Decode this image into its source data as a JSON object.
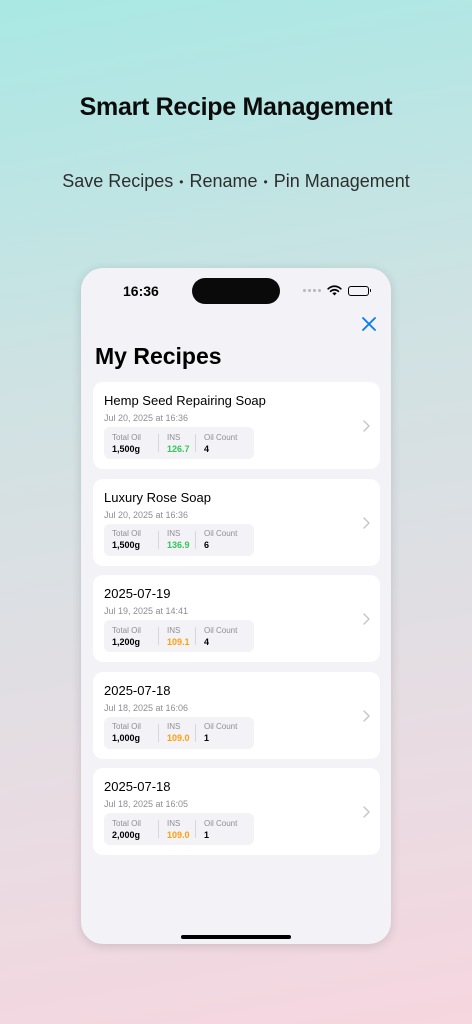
{
  "headline": "Smart Recipe Management",
  "subline": {
    "item1": "Save Recipes",
    "item2": "Rename",
    "item3": "Pin Management",
    "separator": "•"
  },
  "status_bar": {
    "time": "16:36"
  },
  "screen": {
    "title": "My Recipes",
    "close_icon": "close-icon",
    "stat_labels": {
      "total_oil": "Total Oil",
      "ins": "INS",
      "oil_count": "Oil Count"
    }
  },
  "colors": {
    "accent": "#007aff",
    "ins_green": "#34c759",
    "ins_orange": "#ff9f0a"
  },
  "recipes": [
    {
      "name": "Hemp Seed Repairing Soap",
      "date": "Jul 20, 2025 at 16:36",
      "total_oil": "1,500g",
      "ins": "126.7",
      "ins_status": "green",
      "oil_count": "4"
    },
    {
      "name": "Luxury Rose Soap",
      "date": "Jul 20, 2025 at 16:36",
      "total_oil": "1,500g",
      "ins": "136.9",
      "ins_status": "green",
      "oil_count": "6"
    },
    {
      "name": "2025-07-19",
      "date": "Jul 19, 2025 at 14:41",
      "total_oil": "1,200g",
      "ins": "109.1",
      "ins_status": "orange",
      "oil_count": "4"
    },
    {
      "name": "2025-07-18",
      "date": "Jul 18, 2025 at 16:06",
      "total_oil": "1,000g",
      "ins": "109.0",
      "ins_status": "orange",
      "oil_count": "1"
    },
    {
      "name": "2025-07-18",
      "date": "Jul 18, 2025 at 16:05",
      "total_oil": "2,000g",
      "ins": "109.0",
      "ins_status": "orange",
      "oil_count": "1"
    }
  ]
}
